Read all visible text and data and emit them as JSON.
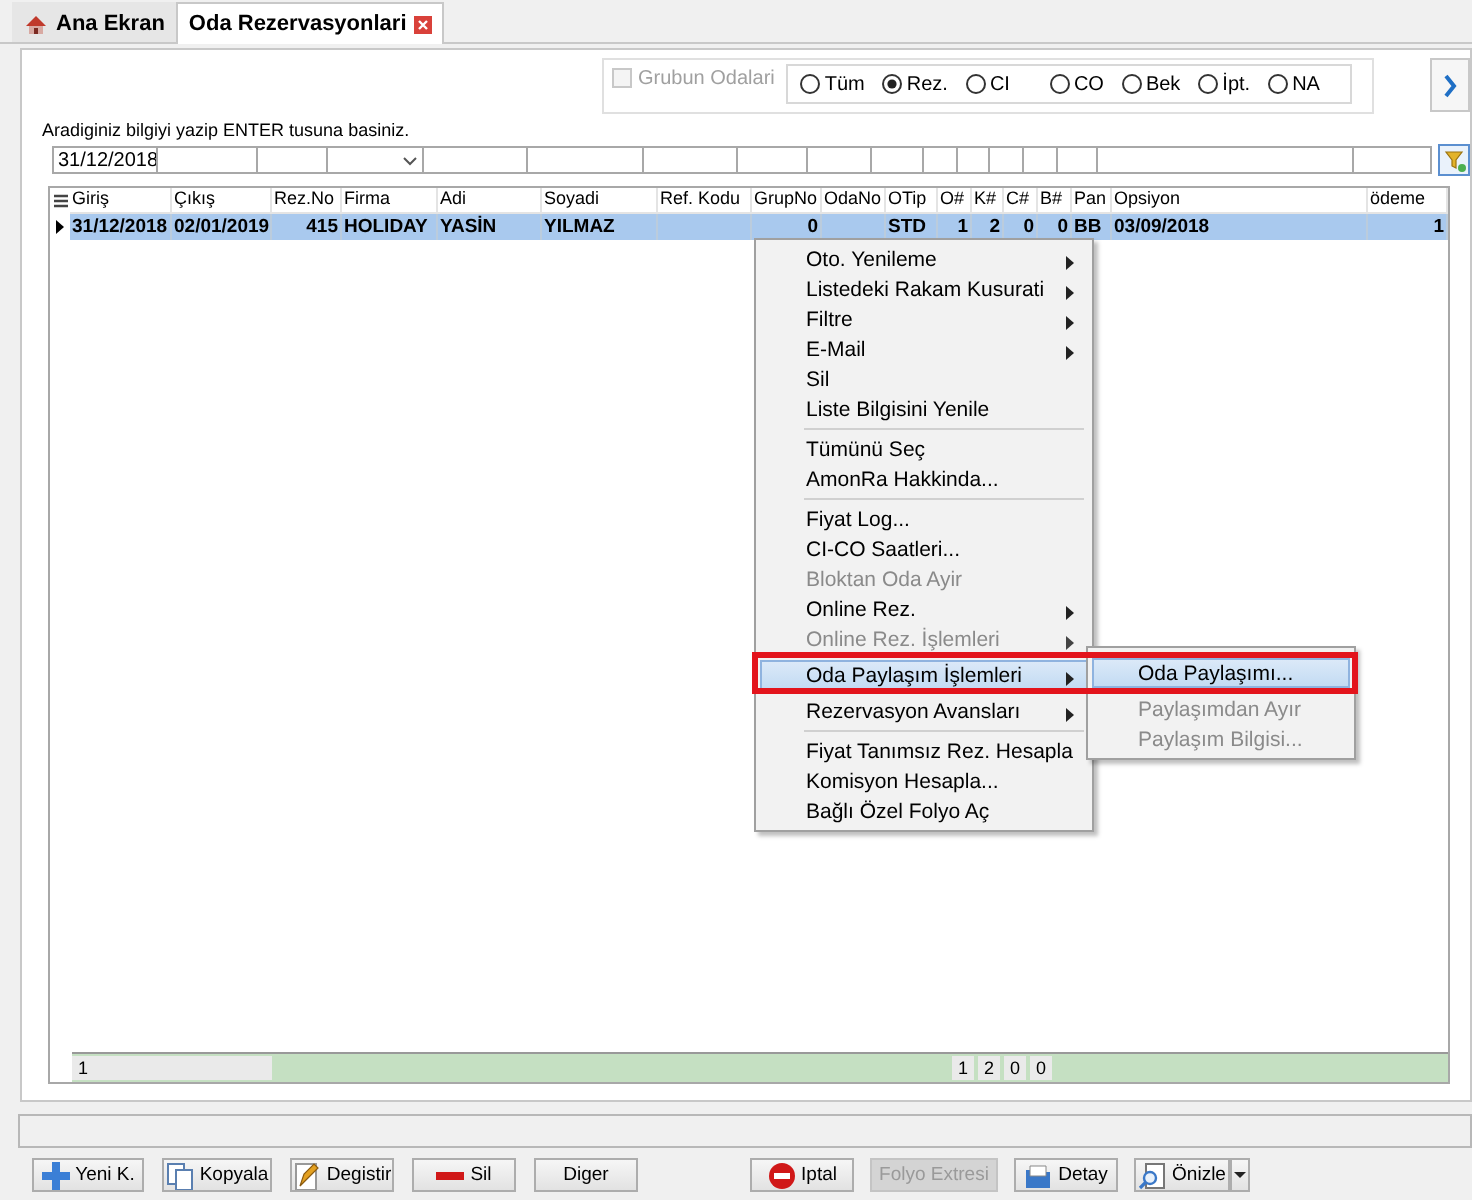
{
  "tabs": [
    {
      "label": "Ana Ekran",
      "kind": "home",
      "selected": false
    },
    {
      "label": "Oda Rezervasyonlari",
      "kind": "closable",
      "selected": true
    }
  ],
  "search": {
    "group_checkbox": {
      "label": "Grubun Odalari",
      "checked": false,
      "disabled": true
    },
    "status_options": [
      {
        "label": "Tüm",
        "selected": false
      },
      {
        "label": "Rez.",
        "selected": true
      },
      {
        "label": "CI",
        "selected": false
      },
      {
        "label": "CO",
        "selected": false
      },
      {
        "label": "Bek",
        "selected": false
      },
      {
        "label": "İpt.",
        "selected": false
      },
      {
        "label": "NA",
        "selected": false
      }
    ],
    "hint": "Aradiginiz bilgiyi yazip ENTER tusuna basiniz.",
    "filter_fields": [
      {
        "kind": "text",
        "value": "31/12/2018"
      },
      {
        "kind": "text"
      },
      {
        "kind": "text"
      },
      {
        "kind": "dropdown"
      },
      {
        "kind": "text"
      },
      {
        "kind": "text"
      },
      {
        "kind": "text"
      },
      {
        "kind": "text"
      },
      {
        "kind": "text"
      },
      {
        "kind": "text"
      },
      {
        "kind": "text"
      },
      {
        "kind": "text"
      },
      {
        "kind": "text"
      },
      {
        "kind": "text"
      },
      {
        "kind": "text"
      },
      {
        "kind": "text"
      },
      {
        "kind": "text"
      }
    ]
  },
  "table": {
    "columns": [
      "Giriş",
      "Çıkış",
      "Rez.No",
      "Firma",
      "Adi",
      "Soyadi",
      "Ref. Kodu",
      "GrupNo",
      "OdaNo",
      "OTip",
      "O#",
      "K#",
      "C#",
      "B#",
      "Pan",
      "Opsiyon",
      "ödeme"
    ],
    "rows": [
      {
        "selected": true,
        "cells": [
          "31/12/2018",
          "02/01/2019",
          "415",
          "HOLIDAY",
          "YASİN",
          "YILMAZ",
          "",
          "0",
          "",
          "STD",
          "1",
          "2",
          "0",
          "0",
          "BB",
          "03/09/2018",
          "1"
        ]
      }
    ],
    "footer": {
      "count": "1",
      "totals": [
        "1",
        "2",
        "0",
        "0"
      ]
    }
  },
  "context_menu": {
    "items": [
      {
        "kind": "item",
        "label": "Oto. Yenileme",
        "submenu": true,
        "disabled": false,
        "selected": false
      },
      {
        "kind": "item",
        "label": "Listedeki Rakam Kusurati",
        "submenu": true,
        "disabled": false,
        "selected": false
      },
      {
        "kind": "item",
        "label": "Filtre",
        "submenu": true,
        "disabled": false,
        "selected": false
      },
      {
        "kind": "item",
        "label": "E-Mail",
        "submenu": true,
        "disabled": false,
        "selected": false
      },
      {
        "kind": "item",
        "label": "Sil",
        "submenu": false,
        "disabled": false,
        "selected": false
      },
      {
        "kind": "item",
        "label": "Liste Bilgisini Yenile",
        "submenu": false,
        "disabled": false,
        "selected": false
      },
      {
        "kind": "separator"
      },
      {
        "kind": "item",
        "label": "Tümünü Seç",
        "submenu": false,
        "disabled": false,
        "selected": false
      },
      {
        "kind": "item",
        "label": "AmonRa Hakkinda...",
        "submenu": false,
        "disabled": false,
        "selected": false
      },
      {
        "kind": "separator"
      },
      {
        "kind": "item",
        "label": "Fiyat Log...",
        "submenu": false,
        "disabled": false,
        "selected": false
      },
      {
        "kind": "item",
        "label": "CI-CO Saatleri...",
        "submenu": false,
        "disabled": false,
        "selected": false
      },
      {
        "kind": "item",
        "label": "Bloktan Oda Ayir",
        "submenu": false,
        "disabled": true,
        "selected": false
      },
      {
        "kind": "item",
        "label": "Online Rez.",
        "submenu": true,
        "disabled": false,
        "selected": false
      },
      {
        "kind": "item",
        "label": "Online Rez. İşlemleri",
        "submenu": true,
        "disabled": true,
        "selected": false
      },
      {
        "kind": "item",
        "label": "Oda Paylaşım İşlemleri",
        "submenu": true,
        "disabled": false,
        "selected": true
      },
      {
        "kind": "item",
        "label": "Rezervasyon Avansları",
        "submenu": true,
        "disabled": false,
        "selected": false
      },
      {
        "kind": "separator"
      },
      {
        "kind": "item",
        "label": "Fiyat Tanımsız Rez. Hesapla",
        "submenu": false,
        "disabled": false,
        "selected": false
      },
      {
        "kind": "item",
        "label": "Komisyon Hesapla...",
        "submenu": false,
        "disabled": false,
        "selected": false
      },
      {
        "kind": "item",
        "label": "Bağlı Özel Folyo Aç",
        "submenu": false,
        "disabled": false,
        "selected": false
      }
    ],
    "submenu": [
      {
        "label": "Oda Paylaşımı...",
        "disabled": false,
        "selected": true
      },
      {
        "label": "Paylaşımdan Ayır",
        "disabled": true,
        "selected": false
      },
      {
        "label": "Paylaşım Bilgisi...",
        "disabled": true,
        "selected": false
      }
    ],
    "highlight_frame": true
  },
  "buttons": [
    {
      "label": "Yeni K.",
      "disabled": false
    },
    {
      "label": "Kopyala",
      "disabled": false
    },
    {
      "label": "Degistir",
      "disabled": false
    },
    {
      "label": "Sil",
      "disabled": false
    },
    {
      "label": "Diger",
      "disabled": false
    },
    {
      "label": "Iptal",
      "disabled": false
    },
    {
      "label": "Folyo Extresi",
      "disabled": true
    },
    {
      "label": "Detay",
      "disabled": false
    },
    {
      "label": "Önizle",
      "disabled": false,
      "dropdown": true
    }
  ]
}
